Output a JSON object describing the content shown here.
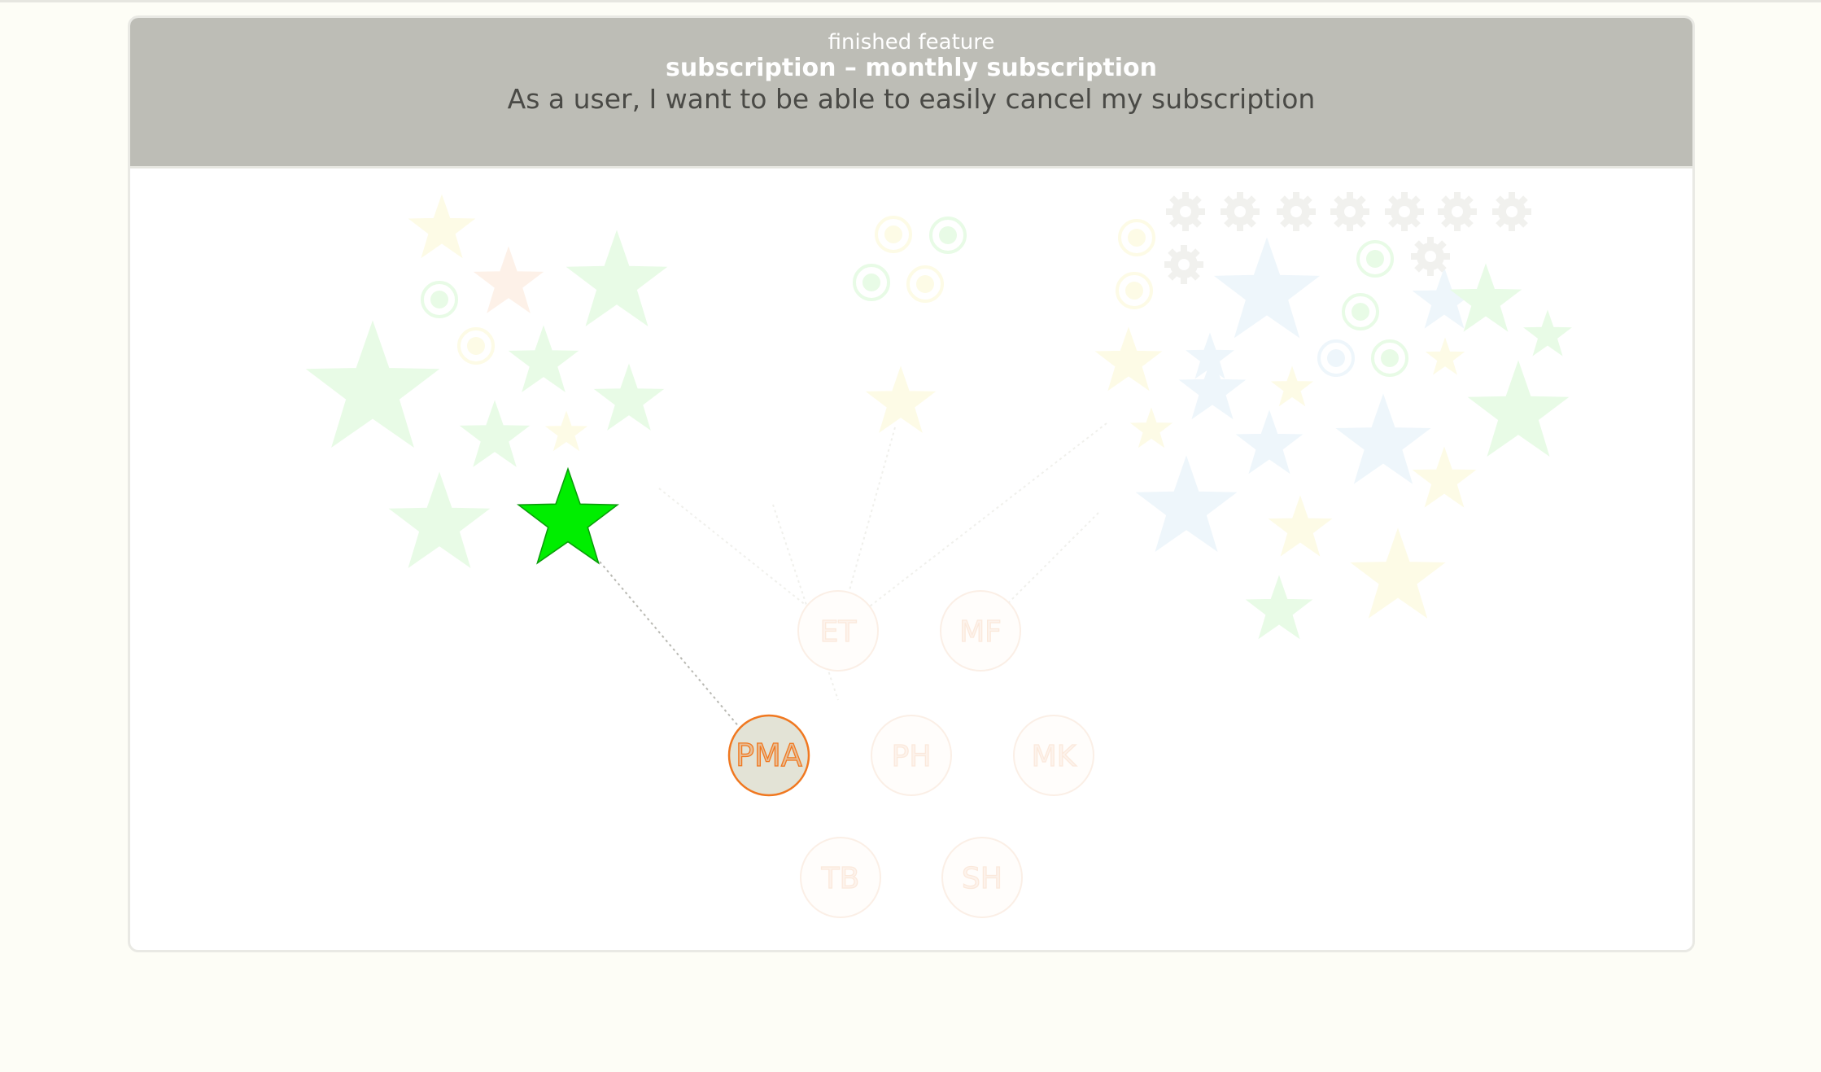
{
  "header": {
    "feature_state": "finished feature",
    "feature_title": "subscription – monthly subscription",
    "user_story": "As a user, I want to be able to easily cancel my subscription"
  },
  "team": {
    "members": [
      {
        "initials": "ET",
        "active": false
      },
      {
        "initials": "MF",
        "active": false
      },
      {
        "initials": "PMA",
        "active": true
      },
      {
        "initials": "PH",
        "active": false
      },
      {
        "initials": "MK",
        "active": false
      },
      {
        "initials": "TB",
        "active": false
      },
      {
        "initials": "SH",
        "active": false
      }
    ]
  },
  "colors": {
    "header_bg": "#bdbdb6",
    "active_star": "#00ee00",
    "active_member_stroke": "#f07820",
    "active_member_fill": "#e3e3d6",
    "faded_green": "#e8fbe6",
    "faded_yellow": "#fdfbe6",
    "faded_orange": "#fdf1e8",
    "faded_blue": "#eef6fb"
  },
  "icons": {
    "star": "star-icon",
    "gear": "gear-icon",
    "ring": "ring-icon"
  }
}
